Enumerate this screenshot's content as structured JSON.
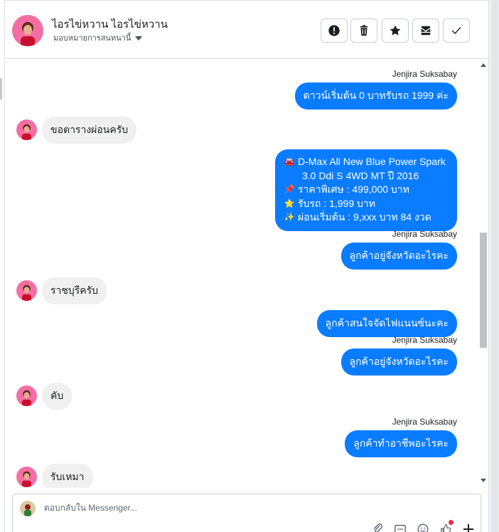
{
  "header": {
    "contact_name": "ไอรไข่หวาน ไอรไข่หวาน",
    "assign_label": "มอบหมายการสนทนานี้",
    "tools": [
      {
        "icon": "alert-icon"
      },
      {
        "icon": "trash-icon"
      },
      {
        "icon": "star-icon"
      },
      {
        "icon": "archive-mail-icon"
      },
      {
        "icon": "check-icon"
      }
    ]
  },
  "messages": [
    {
      "sender": "Jenjira Suksabay",
      "text": "ดาวน์เริ่มต้น 0 บาทรับรถ 1999 ค่ะ"
    },
    {
      "from": "customer",
      "text": "ขอตารางผ่อนครับ"
    },
    {
      "from": "page",
      "lines": [
        {
          "emoji": "🚘",
          "text": "D-Max All New Blue Power Spark"
        },
        {
          "emoji": "",
          "text": "3.0 Ddi S 4WD MT ปี 2016"
        },
        {
          "emoji": "📌",
          "text": "ราคาพิเศษ : 499,000 บาท"
        },
        {
          "emoji": "⭐",
          "text": "รับรถ : 1,999 บาท"
        },
        {
          "emoji": "✨",
          "text": "ผ่อนเริ่มต้น : 9,xxx บาท 84 งวด"
        }
      ]
    },
    {
      "sender": "Jenjira Suksabay",
      "text": "ลูกค้าอยู่จังหวัดอะไรคะ"
    },
    {
      "from": "customer",
      "text": "ราชบุรีครับ"
    },
    {
      "from": "page",
      "text": "ลูกค้าสนใจจัดไฟแนนซ์นะคะ"
    },
    {
      "sender": "Jenjira Suksabay",
      "text": "ลูกค้าอยู่จังหวัดอะไรคะ"
    },
    {
      "from": "customer",
      "text": "คับ"
    },
    {
      "sender": "Jenjira Suksabay",
      "text": "ลูกค้าทำอาชีพอะไรคะ"
    },
    {
      "from": "customer",
      "text": "รับเหมา"
    }
  ],
  "composer": {
    "placeholder": "ตอบกลับใน Messenger...",
    "icons": [
      "attachment-icon",
      "gif-icon",
      "emoji-icon",
      "like-icon",
      "add-icon"
    ]
  },
  "colors": {
    "outgoing_bubble": "#0a7cff",
    "incoming_bubble": "#f0f0f0",
    "notification_dot": "#f02849"
  }
}
